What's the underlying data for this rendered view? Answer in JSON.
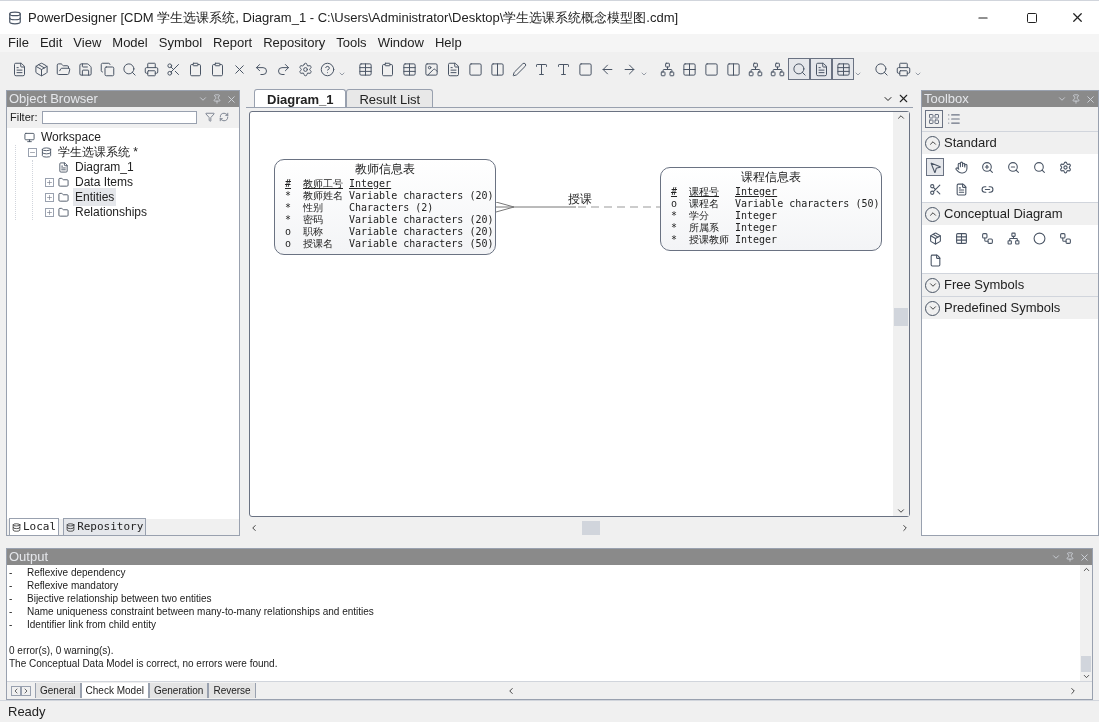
{
  "window": {
    "title": "PowerDesigner [CDM 学生选课系统, Diagram_1 - C:\\Users\\Administrator\\Desktop\\学生选课系统概念模型图.cdm]"
  },
  "menu": [
    "File",
    "Edit",
    "View",
    "Model",
    "Symbol",
    "Report",
    "Repository",
    "Tools",
    "Window",
    "Help"
  ],
  "object_browser": {
    "title": "Object Browser",
    "filter_label": "Filter:",
    "tree": [
      {
        "label": "Workspace",
        "kind": "workspace",
        "selected": false,
        "children": [
          {
            "label": "学生选课系统 *",
            "kind": "model",
            "expanded": true,
            "selected": false,
            "children": [
              {
                "label": "Diagram_1",
                "kind": "diagram",
                "selected": false
              },
              {
                "label": "Data Items",
                "kind": "folder",
                "expanded": false,
                "selected": false
              },
              {
                "label": "Entities",
                "kind": "folder",
                "expanded": false,
                "selected": true
              },
              {
                "label": "Relationships",
                "kind": "folder",
                "expanded": false,
                "selected": false
              }
            ]
          }
        ]
      }
    ],
    "bottom_tabs": [
      {
        "label": "Local",
        "selected": true
      },
      {
        "label": "Repository",
        "selected": false
      }
    ]
  },
  "document_tabs": [
    {
      "label": "Diagram_1",
      "selected": true
    },
    {
      "label": "Result List",
      "selected": false
    }
  ],
  "diagram": {
    "entities": [
      {
        "title": "教师信息表",
        "attributes": [
          {
            "marker": "#",
            "name": "教师工号",
            "type": "Integer",
            "identifier": true
          },
          {
            "marker": "*",
            "name": "教师姓名",
            "type": "Variable characters (20)",
            "identifier": false
          },
          {
            "marker": "*",
            "name": "性别",
            "type": "Characters (2)",
            "identifier": false
          },
          {
            "marker": "*",
            "name": "密码",
            "type": "Variable characters (20)",
            "identifier": false
          },
          {
            "marker": "o",
            "name": "职称",
            "type": "Variable characters (20)",
            "identifier": false
          },
          {
            "marker": "o",
            "name": "授课名",
            "type": "Variable characters (50)",
            "identifier": false
          }
        ]
      },
      {
        "title": "课程信息表",
        "attributes": [
          {
            "marker": "#",
            "name": "课程号",
            "type": "Integer",
            "identifier": true
          },
          {
            "marker": "o",
            "name": "课程名",
            "type": "Variable characters (50)",
            "identifier": false
          },
          {
            "marker": "*",
            "name": "学分",
            "type": "Integer",
            "identifier": false
          },
          {
            "marker": "*",
            "name": "所属系",
            "type": "Integer",
            "identifier": false
          },
          {
            "marker": "*",
            "name": "授课教师",
            "type": "Integer",
            "identifier": false
          }
        ]
      }
    ],
    "relationship": {
      "label": "授课"
    }
  },
  "toolbox": {
    "title": "Toolbox",
    "sections": [
      {
        "label": "Standard",
        "expanded": true
      },
      {
        "label": "Conceptual Diagram",
        "expanded": true
      },
      {
        "label": "Free Symbols",
        "expanded": false
      },
      {
        "label": "Predefined Symbols",
        "expanded": false
      }
    ]
  },
  "output": {
    "title": "Output",
    "lines": [
      {
        "kind": "bullet",
        "text": "Reflexive dependency"
      },
      {
        "kind": "bullet",
        "text": "Reflexive mandatory"
      },
      {
        "kind": "bullet",
        "text": "Bijective relationship between two entities"
      },
      {
        "kind": "bullet",
        "text": "Name uniqueness constraint between many-to-many relationships and entities"
      },
      {
        "kind": "bullet",
        "text": "Identifier link from child entity"
      },
      {
        "kind": "plain",
        "text": "0 error(s),  0 warning(s)."
      },
      {
        "kind": "plain",
        "text": "The Conceptual Data Model is correct, no errors were found."
      }
    ],
    "bullet_mark": "-",
    "tabs": [
      {
        "label": "General",
        "selected": false
      },
      {
        "label": "Check Model",
        "selected": true
      },
      {
        "label": "Generation",
        "selected": false
      },
      {
        "label": "Reverse",
        "selected": false
      }
    ]
  },
  "status_bar": {
    "text": "Ready"
  }
}
